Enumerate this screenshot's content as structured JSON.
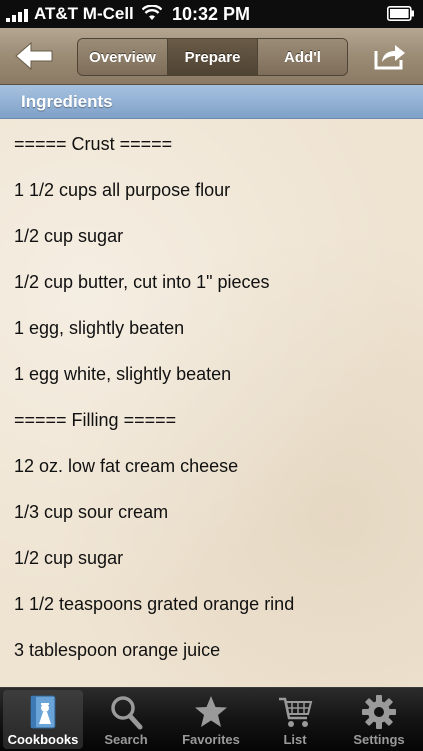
{
  "status_bar": {
    "carrier": "AT&T M-Cell",
    "time": "10:32 PM"
  },
  "nav": {
    "segments": [
      "Overview",
      "Prepare",
      "Add'l"
    ],
    "active_segment": "Prepare"
  },
  "section": {
    "title": "Ingredients"
  },
  "ingredients": [
    "===== Crust =====",
    "1 1/2 cups all purpose flour",
    "1/2 cup sugar",
    "1/2 cup butter, cut into 1\" pieces",
    "1 egg, slightly beaten",
    "1 egg white, slightly beaten",
    "===== Filling =====",
    "12 oz. low fat cream cheese",
    "1/3 cup sour cream",
    "1/2 cup sugar",
    "1 1/2 teaspoons grated orange rind",
    "3 tablespoon orange juice"
  ],
  "tabs": [
    {
      "label": "Cookbooks",
      "icon": "cookbook-icon"
    },
    {
      "label": "Search",
      "icon": "search-icon"
    },
    {
      "label": "Favorites",
      "icon": "star-icon"
    },
    {
      "label": "List",
      "icon": "shopping-cart-icon"
    },
    {
      "label": "Settings",
      "icon": "gear-icon"
    }
  ],
  "active_tab": "Cookbooks",
  "colors": {
    "nav_bar": "#9d8e78",
    "section_header": "#8fb0d4",
    "content_bg": "#efe4d2",
    "tab_bar": "#141414"
  }
}
